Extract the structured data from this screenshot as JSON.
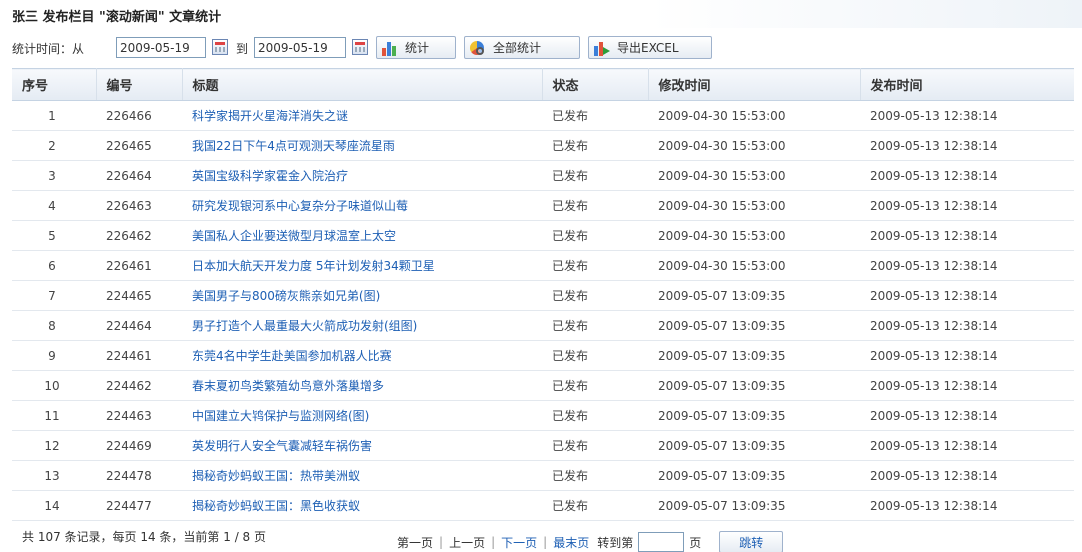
{
  "header": {
    "title": "张三  发布栏目 \"滚动新闻\" 文章统计"
  },
  "filter": {
    "label_time": "统计时间：从",
    "label_to": "到",
    "from_date": "2009-05-19",
    "to_date": "2009-05-19",
    "btn_stats": "统计",
    "btn_all_stats": "全部统计",
    "btn_export": "导出EXCEL"
  },
  "table": {
    "columns": [
      "序号",
      "编号",
      "标题",
      "状态",
      "修改时间",
      "发布时间"
    ],
    "rows": [
      {
        "seq": "1",
        "id": "226466",
        "title": "科学家揭开火星海洋消失之谜",
        "status": "已发布",
        "modified": "2009-04-30 15:53:00",
        "published": "2009-05-13 12:38:14"
      },
      {
        "seq": "2",
        "id": "226465",
        "title": "我国22日下午4点可观测天琴座流星雨",
        "status": "已发布",
        "modified": "2009-04-30 15:53:00",
        "published": "2009-05-13 12:38:14"
      },
      {
        "seq": "3",
        "id": "226464",
        "title": "英国宝级科学家霍金入院治疗",
        "status": "已发布",
        "modified": "2009-04-30 15:53:00",
        "published": "2009-05-13 12:38:14"
      },
      {
        "seq": "4",
        "id": "226463",
        "title": "研究发现银河系中心复杂分子味道似山莓",
        "status": "已发布",
        "modified": "2009-04-30 15:53:00",
        "published": "2009-05-13 12:38:14"
      },
      {
        "seq": "5",
        "id": "226462",
        "title": "美国私人企业要送微型月球温室上太空",
        "status": "已发布",
        "modified": "2009-04-30 15:53:00",
        "published": "2009-05-13 12:38:14"
      },
      {
        "seq": "6",
        "id": "226461",
        "title": "日本加大航天开发力度 5年计划发射34颗卫星",
        "status": "已发布",
        "modified": "2009-04-30 15:53:00",
        "published": "2009-05-13 12:38:14"
      },
      {
        "seq": "7",
        "id": "224465",
        "title": "美国男子与800磅灰熊亲如兄弟(图)",
        "status": "已发布",
        "modified": "2009-05-07 13:09:35",
        "published": "2009-05-13 12:38:14"
      },
      {
        "seq": "8",
        "id": "224464",
        "title": "男子打造个人最重最大火箭成功发射(组图)",
        "status": "已发布",
        "modified": "2009-05-07 13:09:35",
        "published": "2009-05-13 12:38:14"
      },
      {
        "seq": "9",
        "id": "224461",
        "title": "东莞4名中学生赴美国参加机器人比赛",
        "status": "已发布",
        "modified": "2009-05-07 13:09:35",
        "published": "2009-05-13 12:38:14"
      },
      {
        "seq": "10",
        "id": "224462",
        "title": "春末夏初鸟类繁殖幼鸟意外落巢增多",
        "status": "已发布",
        "modified": "2009-05-07 13:09:35",
        "published": "2009-05-13 12:38:14"
      },
      {
        "seq": "11",
        "id": "224463",
        "title": "中国建立大鸨保护与监测网络(图)",
        "status": "已发布",
        "modified": "2009-05-07 13:09:35",
        "published": "2009-05-13 12:38:14"
      },
      {
        "seq": "12",
        "id": "224469",
        "title": "英发明行人安全气囊减轻车祸伤害",
        "status": "已发布",
        "modified": "2009-05-07 13:09:35",
        "published": "2009-05-13 12:38:14"
      },
      {
        "seq": "13",
        "id": "224478",
        "title": "揭秘奇妙蚂蚁王国：热带美洲蚁",
        "status": "已发布",
        "modified": "2009-05-07 13:09:35",
        "published": "2009-05-13 12:38:14"
      },
      {
        "seq": "14",
        "id": "224477",
        "title": "揭秘奇妙蚂蚁王国：黑色收获蚁",
        "status": "已发布",
        "modified": "2009-05-07 13:09:35",
        "published": "2009-05-13 12:38:14"
      }
    ]
  },
  "footer": {
    "summary": "共 107 条记录，每页 14 条，当前第 1 / 8 页",
    "first": "第一页",
    "prev": "上一页",
    "next": "下一页",
    "last": "最末页",
    "goto_label": "转到第",
    "page_unit": "页",
    "jump_button": "跳转"
  },
  "colors": {
    "link": "#1d5fb4",
    "header_bg": "#e4ebf3",
    "border": "#c5d3e3"
  }
}
